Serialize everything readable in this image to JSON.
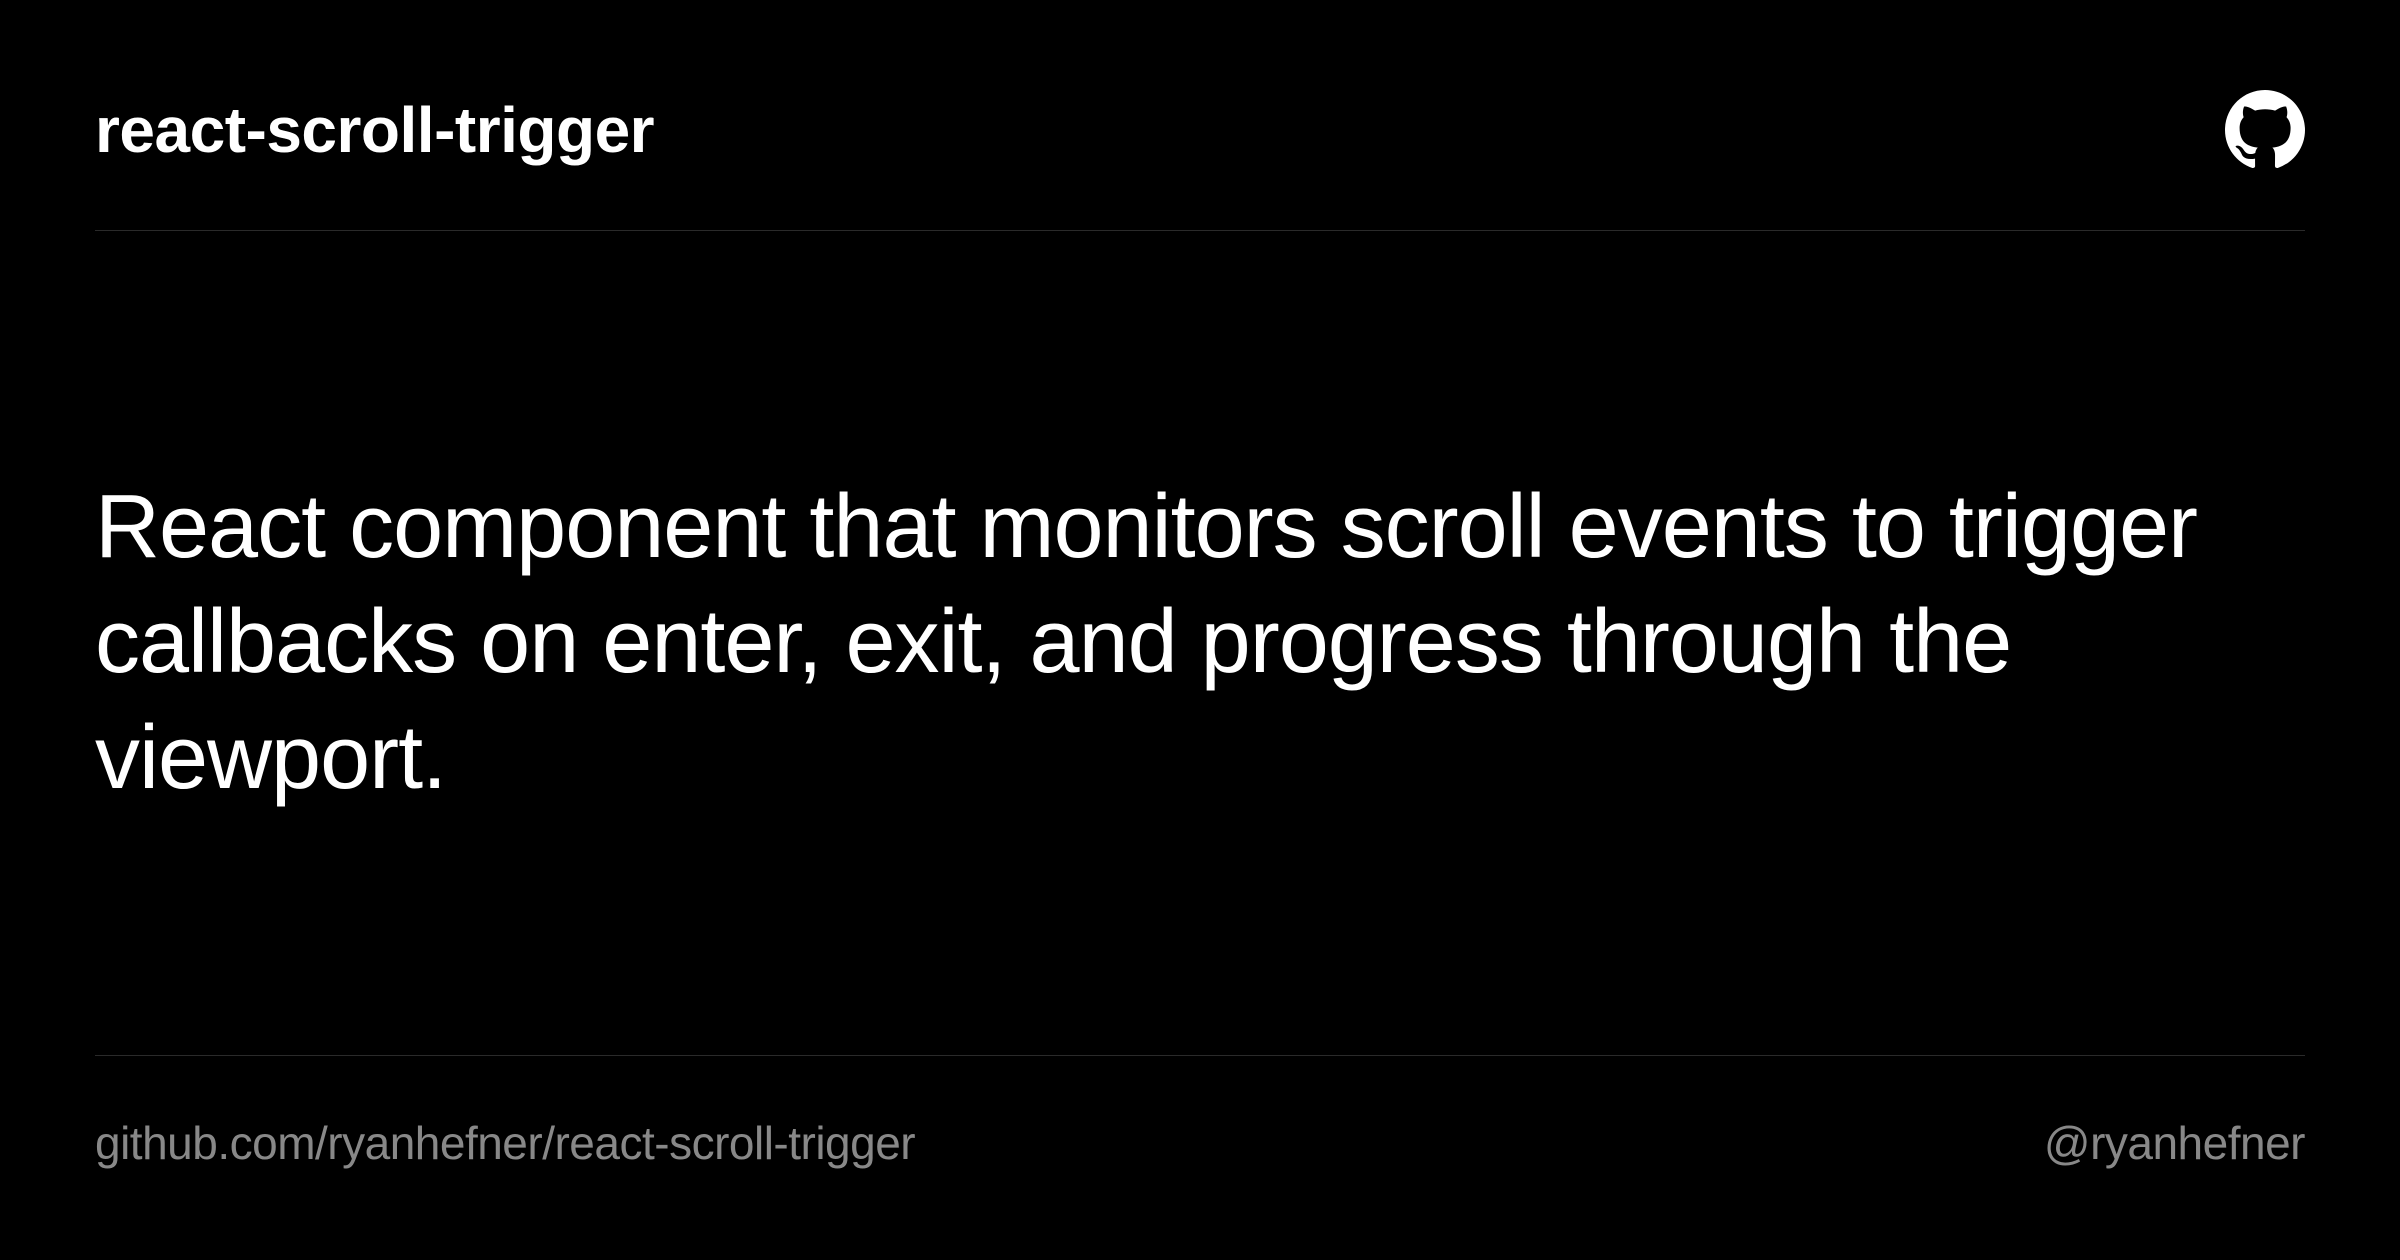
{
  "header": {
    "title": "react-scroll-trigger"
  },
  "main": {
    "description": "React component that monitors scroll events to trigger callbacks on enter, exit, and progress through the viewport."
  },
  "footer": {
    "repo_url": "github.com/ryanhefner/react-scroll-trigger",
    "handle": "@ryanhefner"
  }
}
